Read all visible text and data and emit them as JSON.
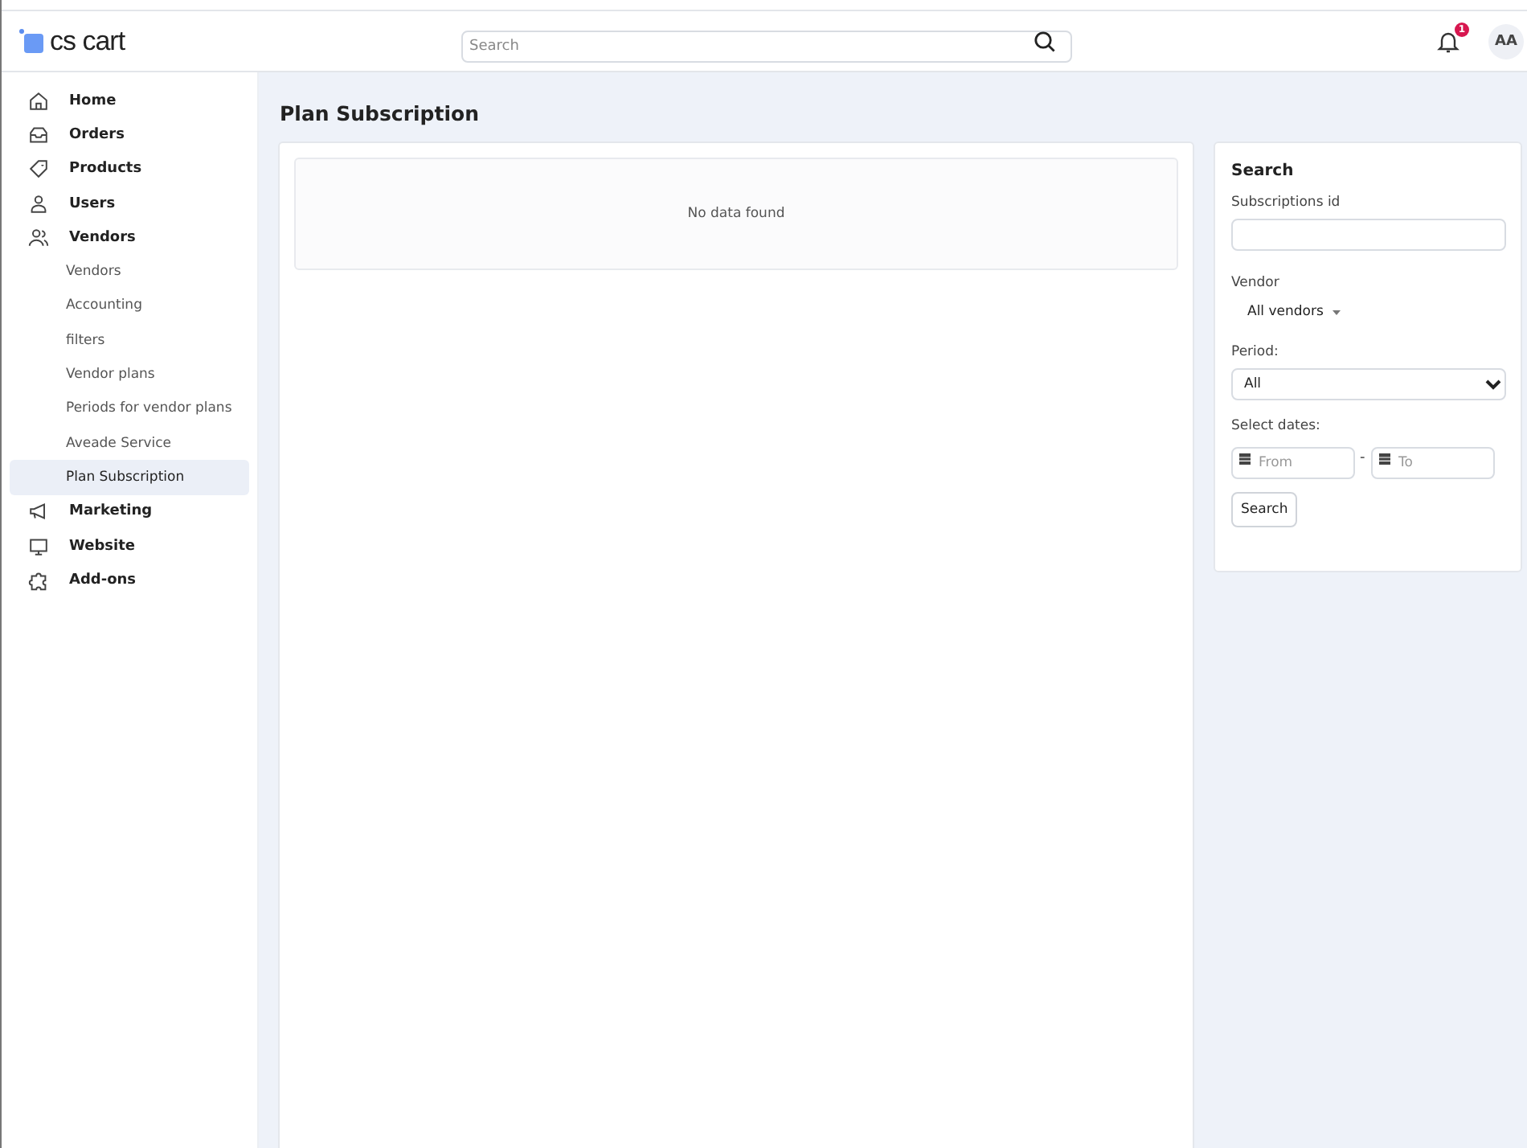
{
  "logo": {
    "text": "cs cart"
  },
  "header": {
    "search": {
      "placeholder": "Search"
    },
    "notifications": {
      "count": "1"
    },
    "avatar": "AA"
  },
  "sidebar": {
    "items": [
      {
        "label": "Home",
        "selected": false
      },
      {
        "label": "Orders",
        "selected": false
      },
      {
        "label": "Products",
        "selected": false
      },
      {
        "label": "Users",
        "selected": false
      },
      {
        "label": "Vendors",
        "selected": false,
        "children": [
          {
            "label": "Vendors",
            "selected": false
          },
          {
            "label": "Accounting",
            "selected": false
          },
          {
            "label": "filters",
            "selected": false
          },
          {
            "label": "Vendor plans",
            "selected": false
          },
          {
            "label": "Periods for vendor plans",
            "selected": false
          },
          {
            "label": "Aveade Service",
            "selected": false
          },
          {
            "label": "Plan Subscription",
            "selected": true
          }
        ]
      },
      {
        "label": "Marketing",
        "selected": false
      },
      {
        "label": "Website",
        "selected": false
      },
      {
        "label": "Add-ons",
        "selected": false
      }
    ]
  },
  "page": {
    "title": "Plan Subscription",
    "empty_message": "No data found"
  },
  "search_panel": {
    "title": "Search",
    "subscriptions_id": {
      "label": "Subscriptions id"
    },
    "vendor": {
      "label": "Vendor",
      "value": "All vendors"
    },
    "period": {
      "label": "Period:",
      "value": "All"
    },
    "dates": {
      "label": "Select dates:",
      "from": {
        "placeholder": "From"
      },
      "separator": "-",
      "to": {
        "placeholder": "To"
      }
    },
    "button": "Search"
  }
}
